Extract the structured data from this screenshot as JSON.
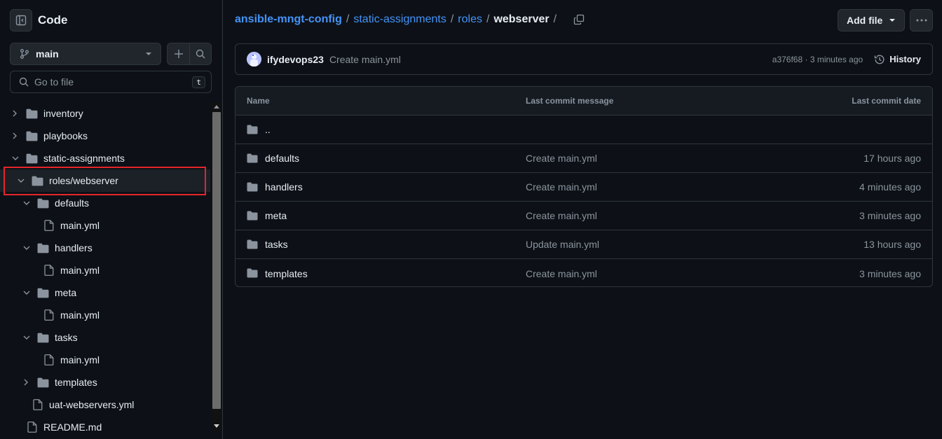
{
  "sidebar": {
    "title": "Code",
    "branch": "main",
    "search": {
      "placeholder": "Go to file",
      "shortcut": "t"
    },
    "tree": [
      {
        "label": "inventory",
        "type": "folder",
        "expanded": false
      },
      {
        "label": "playbooks",
        "type": "folder",
        "expanded": false
      },
      {
        "label": "static-assignments",
        "type": "folder",
        "expanded": true
      },
      {
        "label": "roles/webserver",
        "type": "folder",
        "expanded": true,
        "selected": true
      },
      {
        "label": "defaults",
        "type": "folder",
        "expanded": true
      },
      {
        "label": "main.yml",
        "type": "file"
      },
      {
        "label": "handlers",
        "type": "folder",
        "expanded": true
      },
      {
        "label": "main.yml",
        "type": "file"
      },
      {
        "label": "meta",
        "type": "folder",
        "expanded": true
      },
      {
        "label": "main.yml",
        "type": "file"
      },
      {
        "label": "tasks",
        "type": "folder",
        "expanded": true
      },
      {
        "label": "main.yml",
        "type": "file"
      },
      {
        "label": "templates",
        "type": "folder",
        "expanded": false
      },
      {
        "label": "uat-webservers.yml",
        "type": "file"
      },
      {
        "label": "README.md",
        "type": "file"
      }
    ]
  },
  "breadcrumb": {
    "repo": "ansible-mngt-config",
    "parts": [
      "static-assignments",
      "roles"
    ],
    "current": "webserver",
    "trailing_sep": "/"
  },
  "toolbar": {
    "add_file": "Add file"
  },
  "commit": {
    "author": "ifydevops23",
    "message": "Create main.yml",
    "meta": "a376f68 · 3 minutes ago",
    "history": "History"
  },
  "table": {
    "headers": {
      "name": "Name",
      "message": "Last commit message",
      "date": "Last commit date"
    },
    "parent": "..",
    "rows": [
      {
        "name": "defaults",
        "message": "Create main.yml",
        "date": "17 hours ago"
      },
      {
        "name": "handlers",
        "message": "Create main.yml",
        "date": "4 minutes ago"
      },
      {
        "name": "meta",
        "message": "Create main.yml",
        "date": "3 minutes ago"
      },
      {
        "name": "tasks",
        "message": "Update main.yml",
        "date": "13 hours ago"
      },
      {
        "name": "templates",
        "message": "Create main.yml",
        "date": "3 minutes ago"
      }
    ]
  },
  "colors": {
    "background": "#0d1117",
    "link": "#4493f8",
    "border": "#30363d",
    "muted": "#8b949e",
    "selection_indicator": "#4c6bf5",
    "annotation_box": "#e5252a"
  }
}
